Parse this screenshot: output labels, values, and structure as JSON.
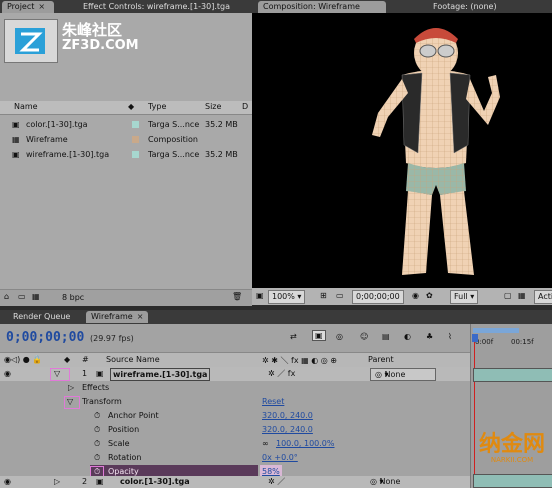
{
  "project_tabs": {
    "project": "Project",
    "effect_controls": "Effect Controls: wireframe.[1-30].tga",
    "close": "×"
  },
  "watermark": {
    "title": "朱峰社区",
    "subtitle": "ZF3D.COM"
  },
  "project_table": {
    "headers": [
      "Name",
      "Type",
      "Size",
      "D"
    ],
    "rows": [
      {
        "name": "color.[1-30].tga",
        "type": "Targa S...nce",
        "size": "35.2 MB",
        "swatch": "#a7d7cf"
      },
      {
        "name": "Wireframe",
        "type": "Composition",
        "size": "",
        "swatch": "#c9a98a"
      },
      {
        "name": "wireframe.[1-30].tga",
        "type": "Targa S...nce",
        "size": "35.2 MB",
        "swatch": "#a7d7cf"
      }
    ]
  },
  "project_footer": {
    "bpc": "8 bpc"
  },
  "comp_tabs": {
    "composition": "Composition: Wireframe",
    "footage": "Footage: (none)"
  },
  "viewer": {
    "zoom": "100%",
    "timecode": "0;00;00;00",
    "resolution": "Full",
    "active": "Acti"
  },
  "timeline_tabs": {
    "render_queue": "Render Queue",
    "wireframe": "Wireframe"
  },
  "timeline": {
    "timecode": "0;00;00;00",
    "fps": "(29.97 fps)",
    "header": {
      "num": "#",
      "source": "Source Name",
      "parent": "Parent"
    },
    "ruler": {
      "start": "0:00f",
      "mark": "00:15f"
    },
    "layers": [
      {
        "num": "1",
        "name": "wireframe.[1-30].tga",
        "parent": "None"
      },
      {
        "num": "2",
        "name": "color.[1-30].tga",
        "parent": "None"
      }
    ],
    "effects_label": "Effects",
    "transform_label": "Transform",
    "reset_label": "Reset",
    "properties": [
      {
        "name": "Anchor Point",
        "value": "320.0, 240.0"
      },
      {
        "name": "Position",
        "value": "320.0, 240.0"
      },
      {
        "name": "Scale",
        "value": "100.0, 100.0%"
      },
      {
        "name": "Rotation",
        "value": "0x +0.0°"
      },
      {
        "name": "Opacity",
        "value": "58%"
      }
    ]
  },
  "corner_watermark": {
    "text": "纳金网",
    "sub": "NARKII.COM"
  }
}
